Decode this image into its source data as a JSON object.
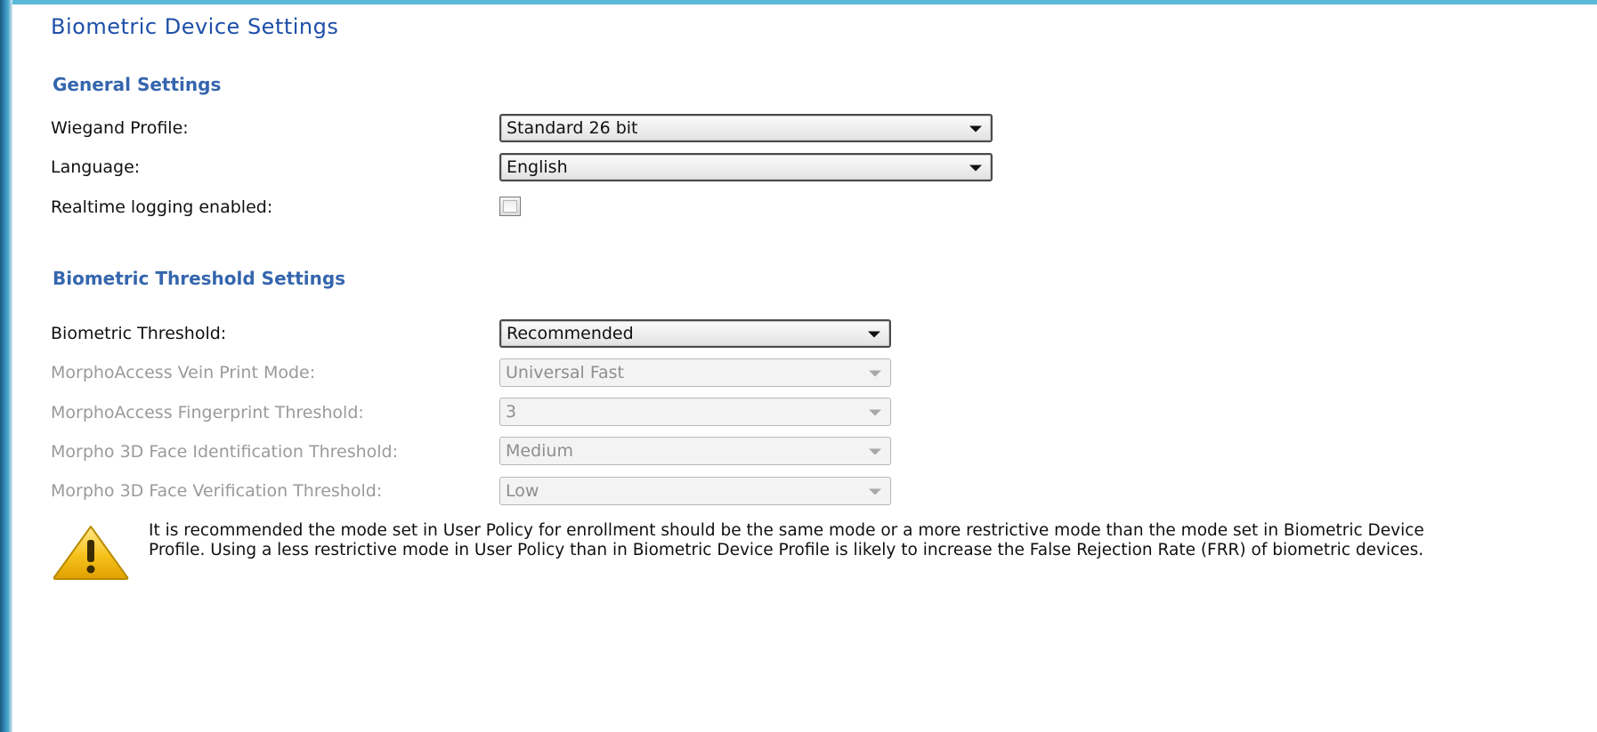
{
  "page": {
    "title": "Biometric Device Settings"
  },
  "general_settings": {
    "heading": "General Settings",
    "wiegand_profile": {
      "label": "Wiegand Profile:",
      "value": "Standard 26 bit"
    },
    "language": {
      "label": "Language:",
      "value": "English"
    },
    "realtime_logging": {
      "label": "Realtime logging enabled:",
      "checked": false
    }
  },
  "threshold_settings": {
    "heading": "Biometric Threshold Settings",
    "biometric_threshold": {
      "label": "Biometric Threshold:",
      "value": "Recommended",
      "enabled": true
    },
    "vein_print_mode": {
      "label": "MorphoAccess Vein Print Mode:",
      "value": "Universal Fast",
      "enabled": false
    },
    "fingerprint_threshold": {
      "label": "MorphoAccess Fingerprint Threshold:",
      "value": "3",
      "enabled": false
    },
    "face_identification_threshold": {
      "label": "Morpho 3D Face Identification Threshold:",
      "value": "Medium",
      "enabled": false
    },
    "face_verification_threshold": {
      "label": "Morpho 3D Face Verification Threshold:",
      "value": "Low",
      "enabled": false
    }
  },
  "warning": {
    "icon": "warning-triangle-icon",
    "text": "It is recommended the mode set in User Policy for enrollment should be the same mode or a more restrictive mode than the mode set in Biometric Device Profile.  Using a less restrictive mode in User Policy than in Biometric Device Profile is likely to increase the False Rejection Rate (FRR) of biometric devices."
  },
  "colors": {
    "title": "#1e4fa8",
    "section_heading": "#3566ae",
    "disabled_text": "#9a9a9a",
    "window_frame": "#5ab8d8",
    "warning_yellow": "#f5c518"
  }
}
